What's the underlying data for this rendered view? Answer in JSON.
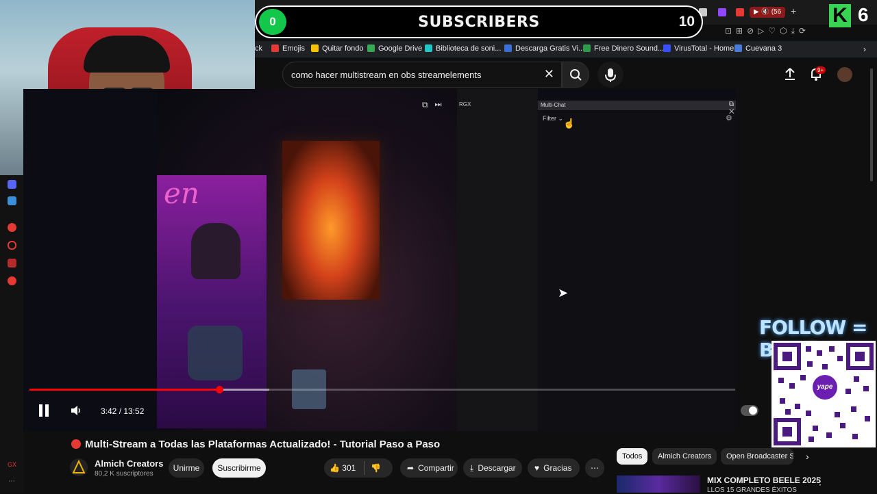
{
  "overlay": {
    "sub_count": "0",
    "sub_label": "SUBSCRIBERS",
    "sub_goal": "10",
    "k_badge": "K",
    "k_number": "6",
    "follow_text": "FOLLOW = BAILE",
    "qr_logo": "yape"
  },
  "bookmarks": [
    {
      "label": "ck",
      "color": "#ffffff"
    },
    {
      "label": "Emojis",
      "color": "#e53935"
    },
    {
      "label": "Quitar fondo",
      "color": "#f9c200"
    },
    {
      "label": "Google Drive",
      "color": "#34a853"
    },
    {
      "label": "Biblioteca de soni...",
      "color": "#21c7c7"
    },
    {
      "label": "Descarga Gratis Vi...",
      "color": "#3a6fd8"
    },
    {
      "label": "Free Dinero Sound...",
      "color": "#2f9a4c"
    },
    {
      "label": "VirusTotal - Home",
      "color": "#394eff"
    },
    {
      "label": "Cuevana 3",
      "color": "#4a7bd8"
    }
  ],
  "browser_tab_counter": "56",
  "search": {
    "query": "como hacer multistream en obs streamelements"
  },
  "notifications_badge": "9+",
  "video": {
    "obs_panel_title": "Multi-Chat",
    "obs_filter_label": "Filter",
    "obs_source_label": "RGX",
    "neon_text": "en",
    "time": "3:42 / 13:52",
    "progress_fraction": 0.2688,
    "buffer_fraction": 0.34
  },
  "title": "Multi-Stream a Todas las Plataformas Actualizado! - Tutorial Paso a Paso",
  "channel": {
    "name": "Almich Creators",
    "subs": "80,2 K suscriptores",
    "join_label": "Unirme",
    "subscribe_label": "Suscribirme"
  },
  "actions": {
    "likes": "301",
    "share": "Compartir",
    "download": "Descargar",
    "thanks": "Gracias"
  },
  "chips": [
    "Todos",
    "Almich Creators",
    "Open Broadcaster So"
  ],
  "recommendation": {
    "title": "MIX COMPLETO BEELE 2025",
    "subtitle": "LLOS 15 GRANDES ÉXITOS"
  },
  "sidebar_bottom": "GX",
  "colors": {
    "accent": "#ff0000",
    "sub_green": "#13c74a"
  }
}
